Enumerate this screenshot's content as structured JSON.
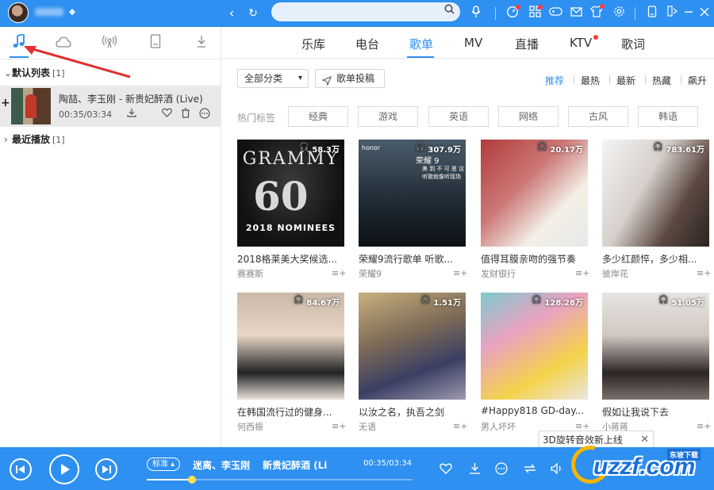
{
  "topbar": {
    "search_value": "",
    "icons": [
      "back-icon",
      "refresh-icon",
      "search-icon",
      "mic-icon",
      "speed-icon",
      "apps-icon",
      "game-icon",
      "mail-icon",
      "skin-icon",
      "settings-icon",
      "mini-mode-icon",
      "minimize-icon",
      "close-icon"
    ]
  },
  "left": {
    "tabs": [
      "music-note-icon",
      "cloud-icon",
      "radio-icon",
      "device-icon",
      "download-icon"
    ],
    "groups": [
      {
        "name": "默认列表",
        "count": "[1]"
      },
      {
        "name": "最近播放",
        "count": "[1]"
      }
    ],
    "song": {
      "title": "陶喆、李玉刚 - 新贵妃醉酒 (Live)",
      "time": "00:35/03:34"
    }
  },
  "nav": {
    "tabs": [
      "乐库",
      "电台",
      "歌单",
      "MV",
      "直播",
      "KTV",
      "歌词"
    ],
    "active": "歌单"
  },
  "filters": {
    "category_label": "全部分类",
    "submit_label": "歌单投稿",
    "sort_options": [
      "推荐",
      "最热",
      "最新",
      "热藏",
      "飙升"
    ],
    "active_sort": "推荐"
  },
  "tags": {
    "label": "热门标签",
    "items": [
      "经典",
      "游戏",
      "英语",
      "网络",
      "古风",
      "韩语"
    ]
  },
  "playlists": [
    {
      "count": "58.3万",
      "title": "2018格莱美大奖候选...",
      "author": "赛赛斯"
    },
    {
      "count": "307.9万",
      "title": "荣耀9流行歌单 听歌...",
      "author": "荣耀9"
    },
    {
      "count": "20.17万",
      "title": "值得耳膜亲吻的强节奏",
      "author": "发财银行"
    },
    {
      "count": "783.61万",
      "title": "多少红颜悴，多少相...",
      "author": "彼岸花"
    },
    {
      "count": "84.67万",
      "title": "在韩国流行过的健身...",
      "author": "何西振"
    },
    {
      "count": "1.51万",
      "title": "以汝之名，执吾之剑",
      "author": "无语"
    },
    {
      "count": "128.28万",
      "title": "#Happy818 GD-day...",
      "author": "男人坏坏"
    },
    {
      "count": "51.05万",
      "title": "假如让我说下去",
      "author": "小蒋蒋"
    }
  ],
  "covers": {
    "grammy_title": "GRAMMY",
    "grammy_num": "60",
    "grammy_sub": "2018 NOMINEES",
    "honor_logo": "honor",
    "honor_line1": "荣耀 9",
    "honor_line2": "美 到 不 可 思 议",
    "honor_line3": "听歌就像听现场"
  },
  "notify": {
    "text": "3D旋转音效新上线",
    "close": "✕"
  },
  "player": {
    "quality": "标准 ▴",
    "artist": "迷离、李玉刚",
    "title": "新贵妃醉酒 (Li",
    "time": "00:35/03:34",
    "progress": 0.17
  },
  "watermark": {
    "text": "uzzf.com",
    "badge": "东坡下载"
  },
  "colors": {
    "accent": "#2e90f0",
    "annotation": "#e03030"
  }
}
